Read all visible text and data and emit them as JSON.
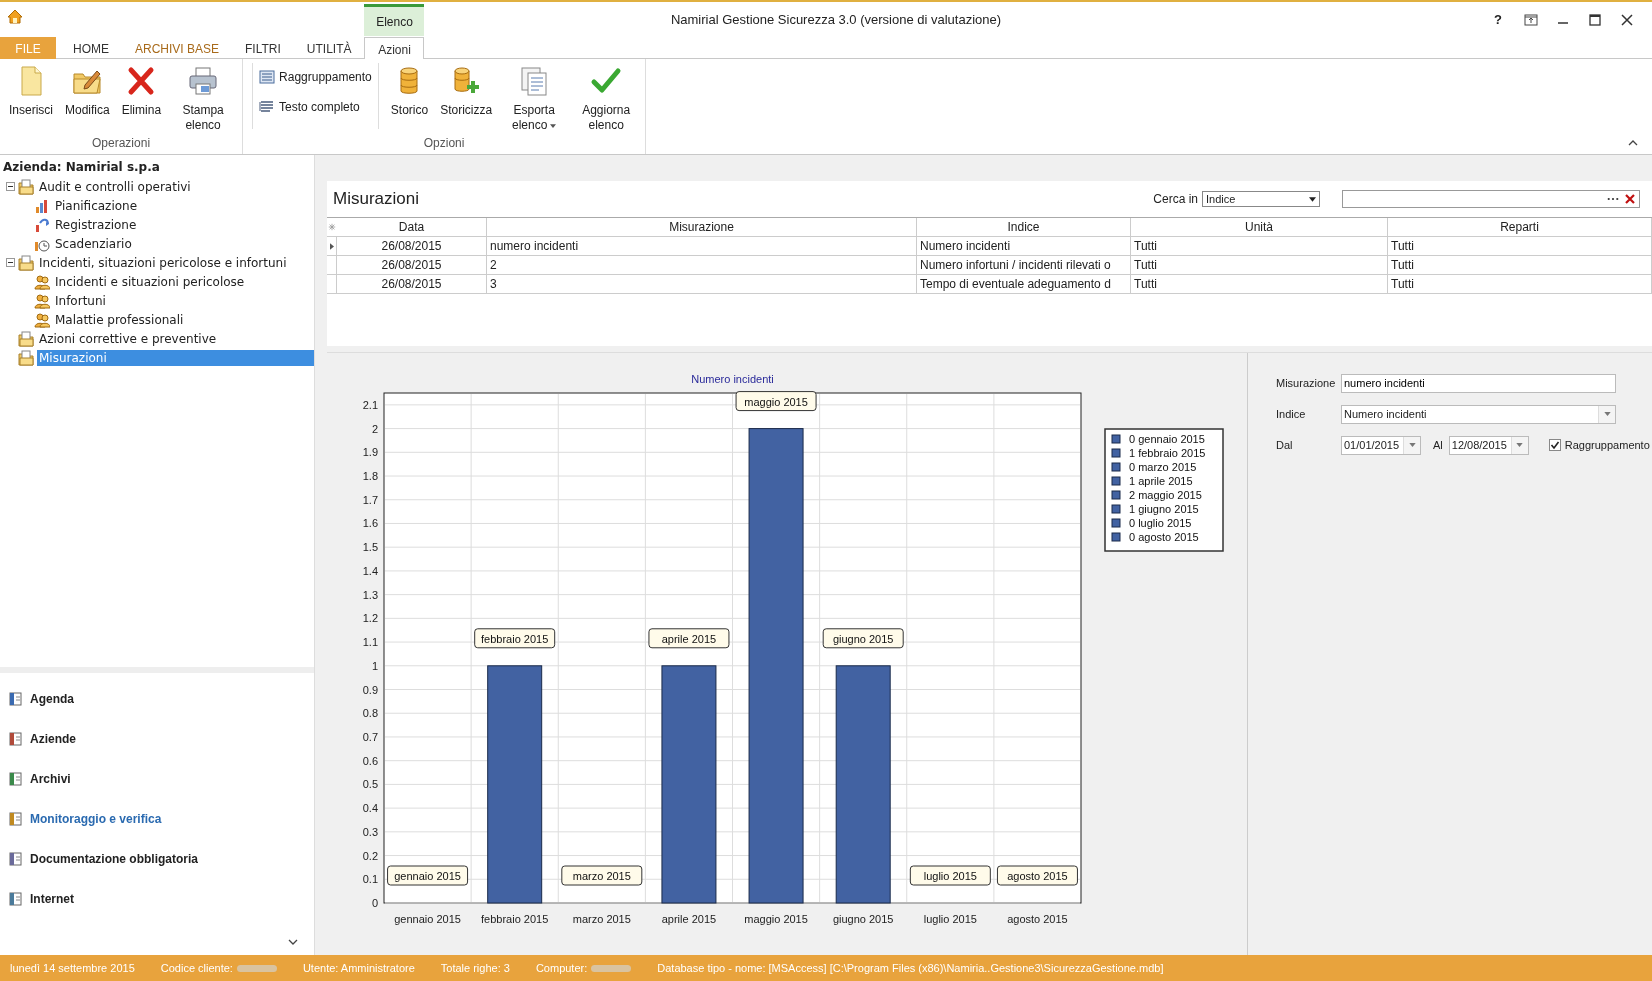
{
  "window": {
    "title": "Namirial Gestione Sicurezza 3.0 (versione di valutazione)",
    "help": "?"
  },
  "ribbon": {
    "contextual_group": "Elenco",
    "tabs": [
      {
        "label": "FILE",
        "kind": "file",
        "selected": false
      },
      {
        "label": "HOME",
        "kind": "plain",
        "selected": false
      },
      {
        "label": "ARCHIVI BASE",
        "kind": "accent",
        "selected": false
      },
      {
        "label": "FILTRI",
        "kind": "plain",
        "selected": false
      },
      {
        "label": "UTILITÀ",
        "kind": "plain",
        "selected": false
      },
      {
        "label": "Azioni",
        "kind": "contextual",
        "selected": true
      }
    ],
    "groups": [
      {
        "label": "Operazioni",
        "items": [
          {
            "kind": "large",
            "label": "Inserisci"
          },
          {
            "kind": "large",
            "label": "Modifica"
          },
          {
            "kind": "large",
            "label": "Elimina"
          },
          {
            "kind": "large",
            "label": "Stampa elenco"
          }
        ]
      },
      {
        "label": "Opzioni",
        "items": [
          {
            "kind": "small",
            "label": "Raggruppamento"
          },
          {
            "kind": "small",
            "label": "Testo completo"
          },
          {
            "kind": "large",
            "label": "Storico"
          },
          {
            "kind": "large",
            "label": "Storicizza"
          },
          {
            "kind": "dropdown",
            "label": "Esporta elenco"
          },
          {
            "kind": "large",
            "label": "Aggiorna elenco"
          }
        ]
      }
    ]
  },
  "sidebar": {
    "company": "Azienda: Namirial s.p.a",
    "tree": [
      {
        "label": "Audit e controlli operativi",
        "expanded": true,
        "selected": false,
        "children": [
          {
            "label": "Pianificazione",
            "selected": false
          },
          {
            "label": "Registrazione",
            "selected": false
          },
          {
            "label": "Scadenziario",
            "selected": false
          }
        ]
      },
      {
        "label": "Incidenti, situazioni pericolose e infortuni",
        "expanded": true,
        "selected": false,
        "children": [
          {
            "label": "Incidenti e situazioni pericolose",
            "selected": false
          },
          {
            "label": "Infortuni",
            "selected": false
          },
          {
            "label": "Malattie professionali",
            "selected": false
          }
        ]
      },
      {
        "label": "Azioni correttive e preventive",
        "selected": false
      },
      {
        "label": "Misurazioni",
        "selected": true
      }
    ],
    "nav": [
      {
        "label": "Agenda",
        "selected": false
      },
      {
        "label": "Aziende",
        "selected": false
      },
      {
        "label": "Archivi",
        "selected": false
      },
      {
        "label": "Monitoraggio e verifica",
        "selected": true
      },
      {
        "label": "Documentazione obbligatoria",
        "selected": false
      },
      {
        "label": "Internet",
        "selected": false
      }
    ]
  },
  "list": {
    "title": "Misurazioni",
    "search_label": "Cerca in",
    "search_scope": "Indice",
    "table": {
      "columns": [
        "Data",
        "Misurazione",
        "Indice",
        "Unità",
        "Reparti"
      ],
      "rows": [
        {
          "selected": true,
          "cells": [
            "26/08/2015",
            "numero incidenti",
            "Numero incidenti",
            "Tutti",
            "Tutti"
          ]
        },
        {
          "selected": false,
          "cells": [
            "26/08/2015",
            "2",
            "Numero infortuni / incidenti rilevati o",
            "Tutti",
            "Tutti"
          ]
        },
        {
          "selected": false,
          "cells": [
            "26/08/2015",
            "3",
            "Tempo di eventuale adeguamento  d",
            "Tutti",
            "Tutti"
          ]
        }
      ]
    }
  },
  "chart_panel": {
    "chart_data": {
      "type": "bar",
      "title": "Numero incidenti",
      "categories": [
        "gennaio 2015",
        "febbraio 2015",
        "marzo 2015",
        "aprile 2015",
        "maggio 2015",
        "giugno 2015",
        "luglio 2015",
        "agosto 2015"
      ],
      "series": [
        {
          "color": "#4262a2",
          "values": [
            0,
            1,
            0,
            1,
            2,
            1,
            0,
            0
          ]
        }
      ],
      "grid": true,
      "ylim": [
        0,
        2.15
      ],
      "yticks": [
        0,
        0.1,
        0.2,
        0.3,
        0.4,
        0.5,
        0.6,
        0.7,
        0.8,
        0.9,
        1,
        1.1,
        1.2,
        1.3,
        1.4,
        1.5,
        1.6,
        1.7,
        1.8,
        1.9,
        2,
        2.1
      ]
    },
    "legend": [
      {
        "text": "0 gennaio 2015"
      },
      {
        "text": "1 febbraio 2015"
      },
      {
        "text": "0 marzo 2015"
      },
      {
        "text": "1 aprile 2015"
      },
      {
        "text": "2 maggio 2015"
      },
      {
        "text": "1 giugno 2015"
      },
      {
        "text": "0 luglio 2015"
      },
      {
        "text": "0 agosto 2015"
      }
    ]
  },
  "form": {
    "measure_label": "Misurazione",
    "measure_value": "numero incidenti",
    "index_label": "Indice",
    "index_value": "Numero incidenti",
    "from_label": "Dal",
    "from_value": "01/01/2015",
    "to_label": "Al",
    "to_value": "12/08/2015",
    "grouping_label": "Raggruppamento",
    "grouping_checked": true
  },
  "status_bar": [
    {
      "text": "lunedì 14 settembre 2015",
      "redacted": false
    },
    {
      "text": "Codice cliente:",
      "redacted": true
    },
    {
      "text": "Utente: Amministratore",
      "redacted": false
    },
    {
      "text": "Totale righe: 3",
      "redacted": false
    },
    {
      "text": "Computer:",
      "redacted": true
    },
    {
      "text": "Database tipo - nome: [MSAccess] [C:\\Program Files (x86)\\Namiria..Gestione3\\SicurezzaGestione.mdb]",
      "redacted": false
    }
  ]
}
